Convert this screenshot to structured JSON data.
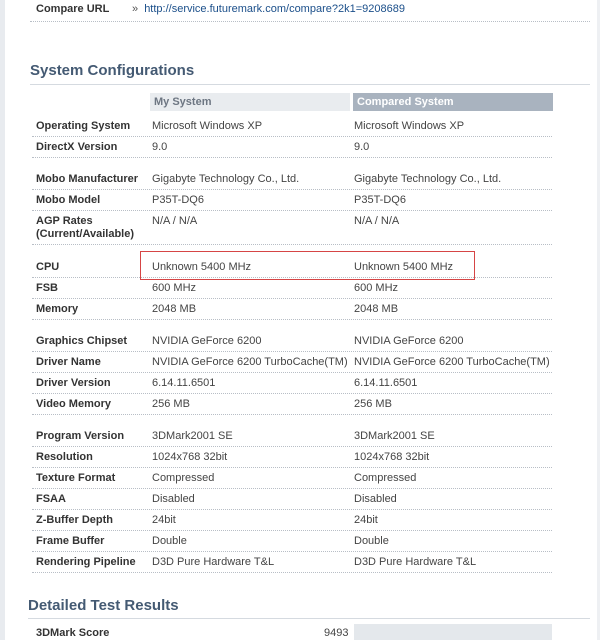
{
  "compare": {
    "label": "Compare URL",
    "arrow": "»",
    "url": "http://service.futuremark.com/compare?2k1=9208689"
  },
  "system": {
    "heading": "System Configurations",
    "col_my": "My System",
    "col_compared": "Compared System",
    "rows": [
      {
        "label": "Operating System",
        "my": "Microsoft Windows XP",
        "cmp": "Microsoft Windows XP"
      },
      {
        "label": "DirectX Version",
        "my": "9.0",
        "cmp": "9.0"
      },
      {
        "label": "Mobo Manufacturer",
        "my": "Gigabyte Technology Co., Ltd.",
        "cmp": "Gigabyte Technology Co., Ltd."
      },
      {
        "label": "Mobo Model",
        "my": "P35T-DQ6",
        "cmp": "P35T-DQ6"
      },
      {
        "label": "AGP Rates",
        "label2": "(Current/Available)",
        "my": "N/A / N/A",
        "cmp": "N/A / N/A"
      },
      {
        "label": "CPU",
        "my": "Unknown 5400 MHz",
        "cmp": "Unknown 5400 MHz"
      },
      {
        "label": "FSB",
        "my": "600 MHz",
        "cmp": "600 MHz"
      },
      {
        "label": "Memory",
        "my": "2048 MB",
        "cmp": "2048 MB"
      },
      {
        "label": "Graphics Chipset",
        "my": "NVIDIA GeForce 6200",
        "cmp": "NVIDIA GeForce 6200"
      },
      {
        "label": "Driver Name",
        "my": "NVIDIA GeForce 6200 TurboCache(TM)",
        "cmp": "NVIDIA GeForce 6200 TurboCache(TM)"
      },
      {
        "label": "Driver Version",
        "my": "6.14.11.6501",
        "cmp": "6.14.11.6501"
      },
      {
        "label": "Video Memory",
        "my": "256 MB",
        "cmp": "256 MB"
      },
      {
        "label": "Program Version",
        "my": "3DMark2001 SE",
        "cmp": "3DMark2001 SE"
      },
      {
        "label": "Resolution",
        "my": "1024x768 32bit",
        "cmp": "1024x768 32bit"
      },
      {
        "label": "Texture Format",
        "my": "Compressed",
        "cmp": "Compressed"
      },
      {
        "label": "FSAA",
        "my": "Disabled",
        "cmp": "Disabled"
      },
      {
        "label": "Z-Buffer Depth",
        "my": "24bit",
        "cmp": "24bit"
      },
      {
        "label": "Frame Buffer",
        "my": "Double",
        "cmp": "Double"
      },
      {
        "label": "Rendering Pipeline",
        "my": "D3D Pure Hardware T&L",
        "cmp": "D3D Pure Hardware T&L"
      }
    ]
  },
  "details": {
    "heading": "Detailed Test Results",
    "score_label": "3DMark Score",
    "score_my": "9493"
  }
}
